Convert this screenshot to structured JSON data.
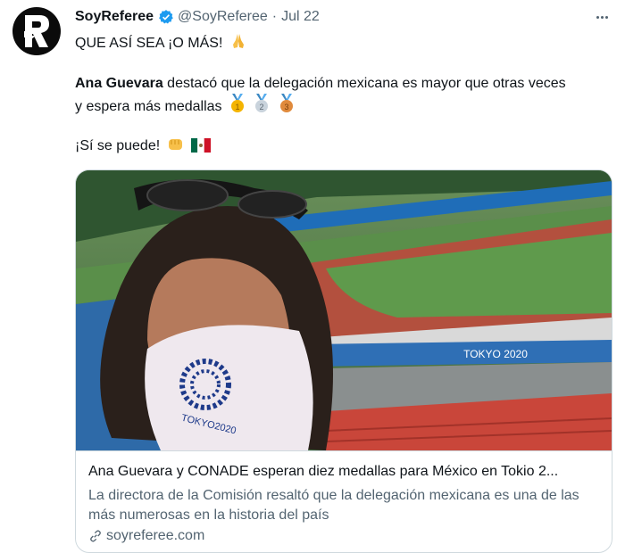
{
  "tweet": {
    "author_name": "SoyReferee",
    "handle": "@SoyReferee",
    "separator": "·",
    "date": "Jul 22",
    "line1": "QUE ASÍ SEA ¡O MÁS!",
    "line2_bold": "Ana Guevara",
    "line2_rest": " destacó que la delegación mexicana es mayor que otras veces",
    "line3": "y espera más medallas",
    "line4": "¡Sí se puede!",
    "medals": [
      "1",
      "2",
      "3"
    ],
    "flag_icon": "mexico-flag-icon",
    "pray_icon": "folded-hands-icon",
    "fist_icon": "fist-icon"
  },
  "card": {
    "title": "Ana Guevara y CONADE esperan diez medallas para México en Tokio 2...",
    "description": "La directora de la Comisión resaltó que la delegación mexicana es una de las más numerosas en la historia del país",
    "domain": "soyreferee.com",
    "mask_text": "TOKYO2020",
    "banner_text": "TOKYO 2020"
  },
  "colors": {
    "text": "#0f1419",
    "secondary": "#536471",
    "verified": "#1d9bf0",
    "border": "#cfd9de"
  }
}
